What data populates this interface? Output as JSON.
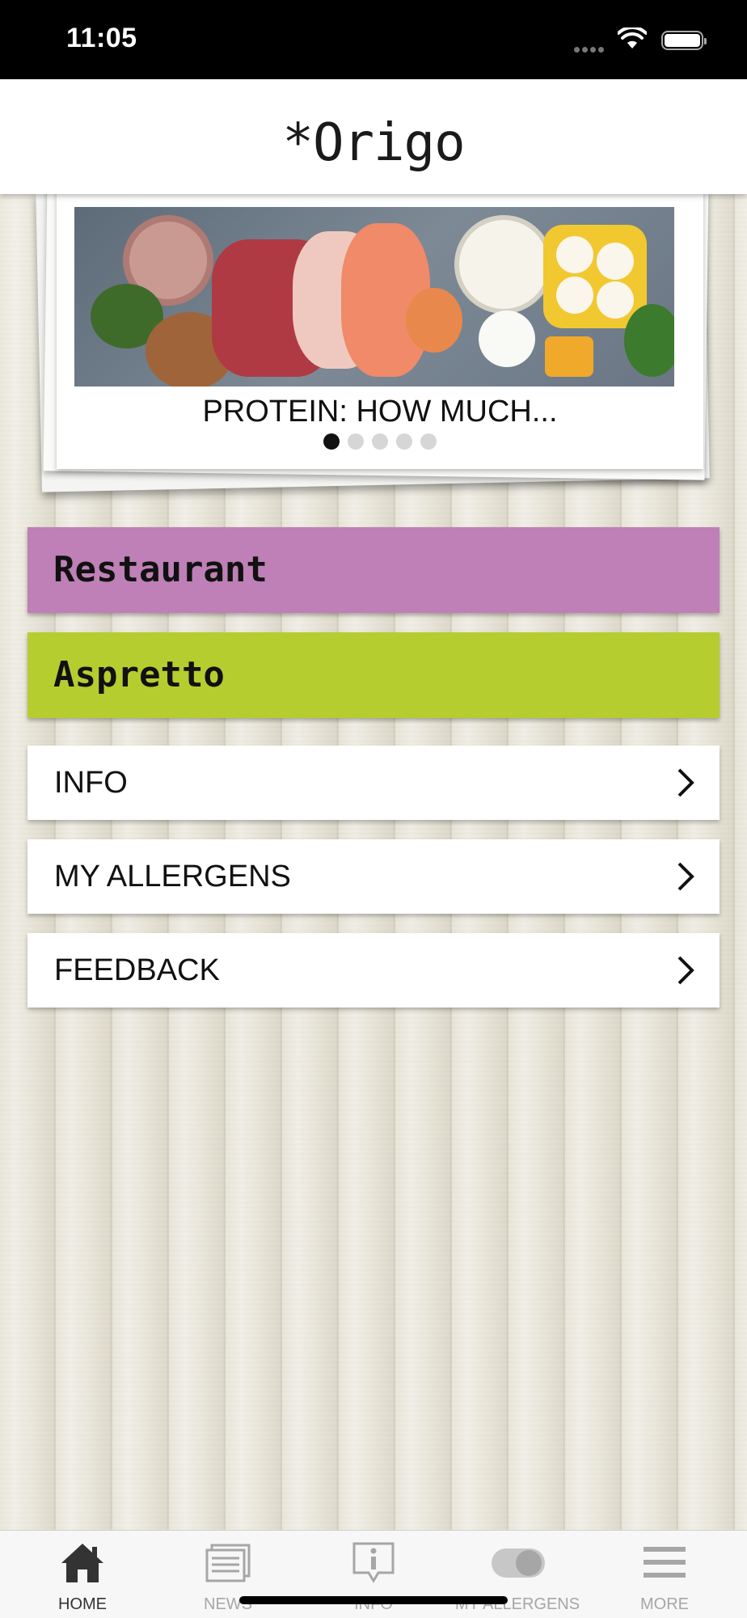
{
  "status_bar": {
    "time": "11:05"
  },
  "header": {
    "logo_text": "*Origo"
  },
  "carousel": {
    "caption": "PROTEIN: HOW MUCH...",
    "slide_count": 5,
    "active_index": 0,
    "image_icon": "food-photo"
  },
  "sections": [
    {
      "label": "Restaurant",
      "color": "#be80b6"
    },
    {
      "label": "Aspretto",
      "color": "#b6cd2f"
    }
  ],
  "menu": [
    {
      "label": "INFO"
    },
    {
      "label": "MY ALLERGENS"
    },
    {
      "label": "FEEDBACK"
    }
  ],
  "tabbar": {
    "tabs": [
      {
        "label": "HOME",
        "icon": "home-icon",
        "active": true
      },
      {
        "label": "NEWS",
        "icon": "news-icon",
        "active": false
      },
      {
        "label": "INFO",
        "icon": "info-icon",
        "active": false
      },
      {
        "label": "MY ALLERGENS",
        "icon": "toggle-icon",
        "active": false
      },
      {
        "label": "MORE",
        "icon": "menu-icon",
        "active": false
      }
    ]
  }
}
